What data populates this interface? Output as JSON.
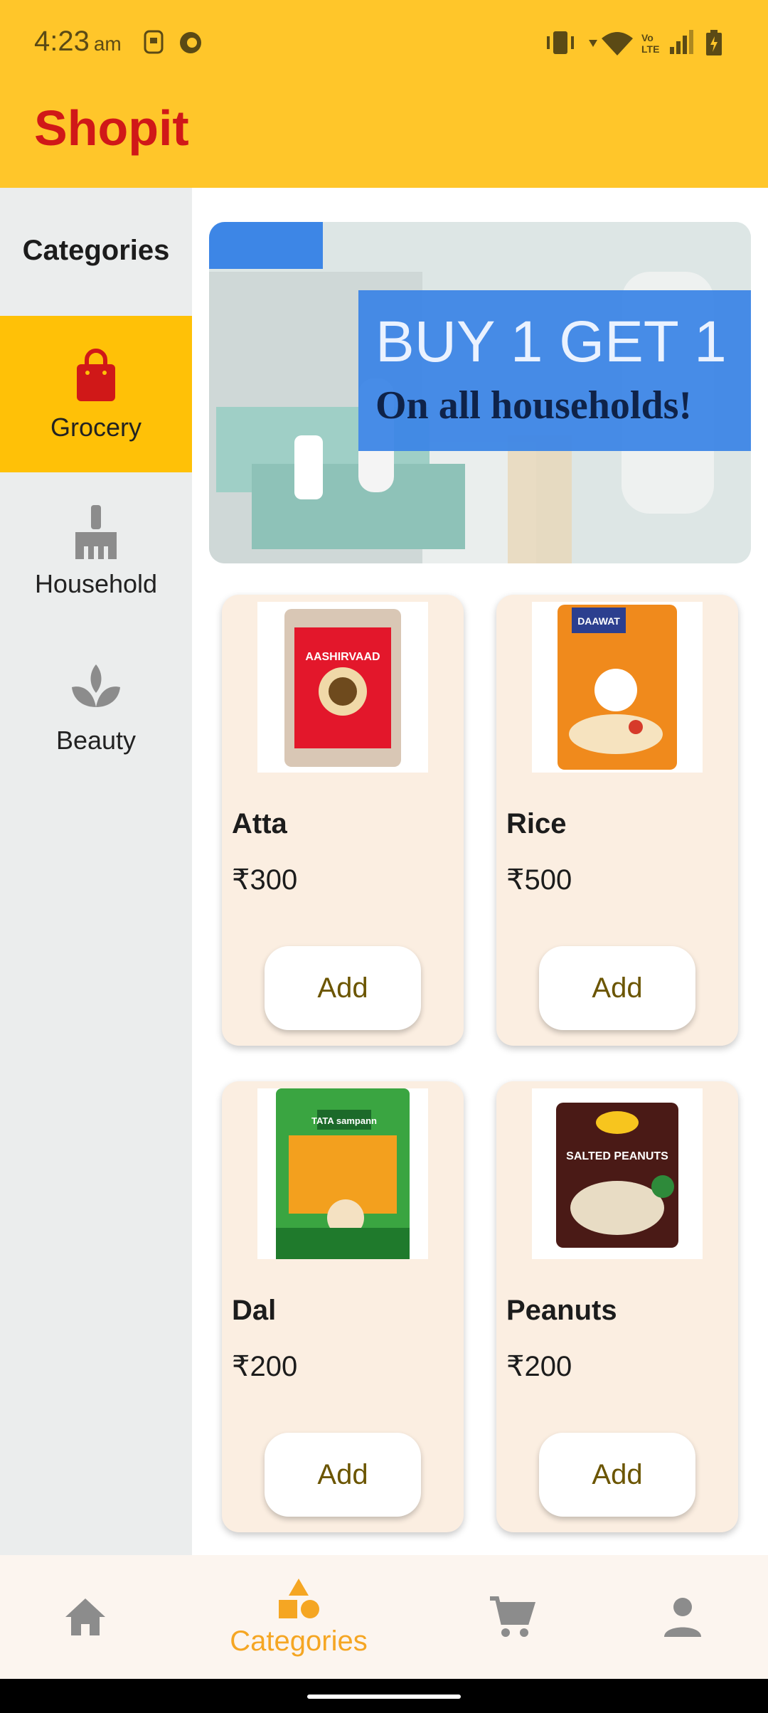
{
  "status_bar": {
    "time": "4:23",
    "ampm": "am"
  },
  "app": {
    "title": "Shopit"
  },
  "sidebar": {
    "title": "Categories",
    "items": [
      {
        "label": "Grocery",
        "icon": "shopping-bag-icon",
        "active": true
      },
      {
        "label": "Household",
        "icon": "broom-icon",
        "active": false
      },
      {
        "label": "Beauty",
        "icon": "lotus-icon",
        "active": false
      }
    ]
  },
  "banner": {
    "headline": "BUY 1 GET 1",
    "subline": "On all households!"
  },
  "products": [
    {
      "name": "Atta",
      "price": "₹300",
      "add_label": "Add",
      "brand": "AASHIRVAAD"
    },
    {
      "name": "Rice",
      "price": "₹500",
      "add_label": "Add",
      "brand": "DAAWAT"
    },
    {
      "name": "Dal",
      "price": "₹200",
      "add_label": "Add",
      "brand": "TATA sampann"
    },
    {
      "name": "Peanuts",
      "price": "₹200",
      "add_label": "Add",
      "brand": "SALTED PEANUTS"
    }
  ],
  "bottom_nav": {
    "items": [
      {
        "icon": "home-icon",
        "label": ""
      },
      {
        "icon": "shapes-icon",
        "label": "Categories"
      },
      {
        "icon": "cart-icon",
        "label": ""
      },
      {
        "icon": "person-icon",
        "label": ""
      }
    ]
  },
  "colors": {
    "accent": "#FFC62A",
    "brand_red": "#D01818",
    "nav_active": "#F5A623"
  }
}
